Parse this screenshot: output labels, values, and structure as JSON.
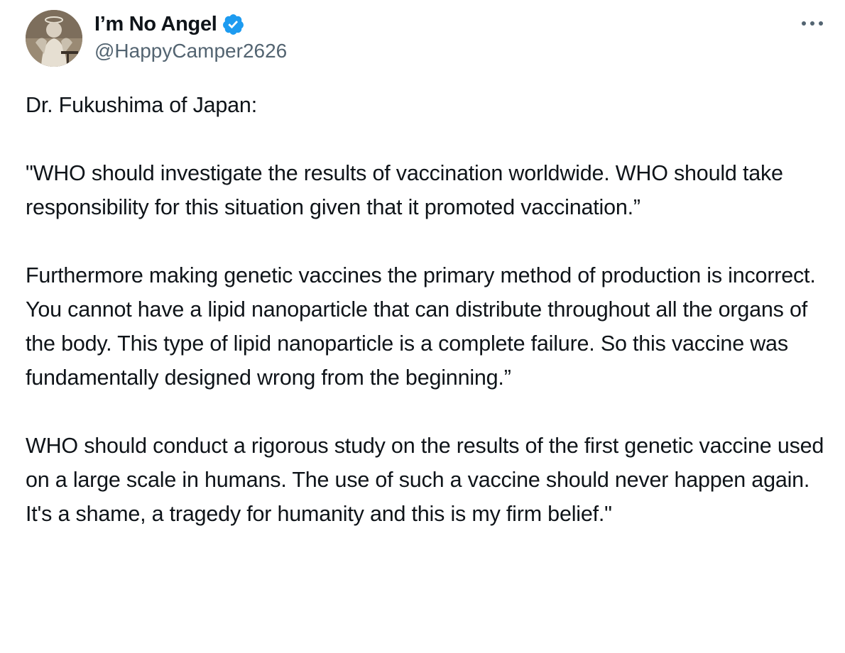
{
  "author": {
    "display_name": "I’m No Angel",
    "handle": "@HappyCamper2626",
    "verified": true,
    "verified_color": "#1d9bf0",
    "avatar_icon": "avatar-photo"
  },
  "menu": {
    "icon": "more-options-icon"
  },
  "tweet": {
    "paragraphs": [
      "Dr. Fukushima of Japan:",
      "\"WHO should investigate the results of vaccination worldwide. WHO should take responsibility for this situation given that it promoted vaccination.”",
      "Furthermore making genetic vaccines the primary method of production is incorrect. You cannot have a lipid nanoparticle that can distribute throughout all the organs of the body. This type of lipid nanoparticle is a complete failure. So this vaccine was fundamentally designed wrong from the beginning.”",
      "WHO should conduct a rigorous study on the results of the first genetic vaccine used on a large scale in humans. The use of such a vaccine should never happen again. It's a shame, a tragedy for humanity and this is my firm belief.\""
    ]
  }
}
